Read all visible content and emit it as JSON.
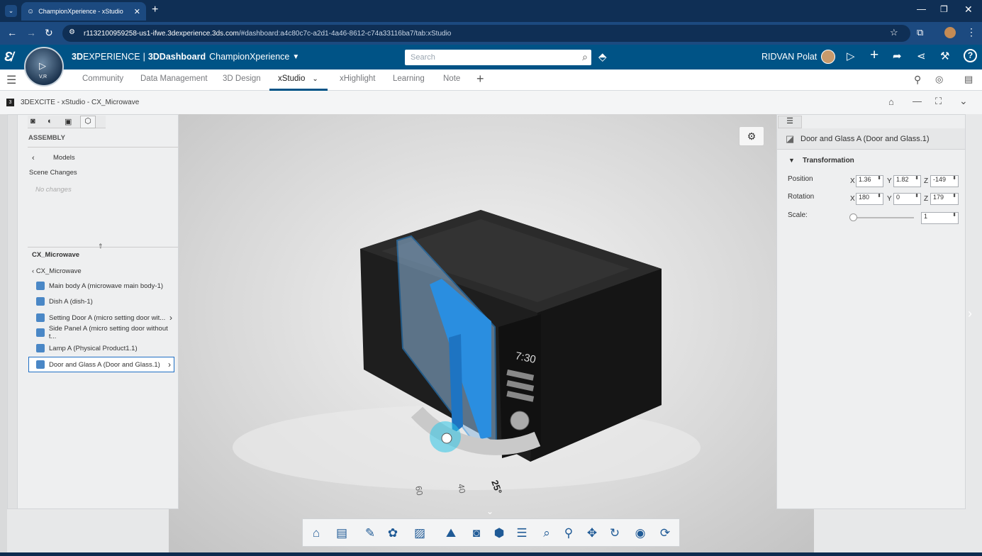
{
  "browser": {
    "tab_title": "ChampionXperience - xStudio",
    "url_host": "r1132100959258-us1-ifwe.3dexperience.3ds.com",
    "url_path": "/#dashboard:a4c80c7c-a2d1-4a46-8612-c74a33116ba7/tab:xStudio"
  },
  "header": {
    "brand_bold": "3D",
    "brand_rest": "EXPERIENCE",
    "sep": "|",
    "app": "3DDashboard",
    "dashboard": "ChampionXperience",
    "search_placeholder": "Search",
    "user": "RIDVAN Polat",
    "compass_label": "V,R"
  },
  "tabs": [
    {
      "label": "Community"
    },
    {
      "label": "Data Management"
    },
    {
      "label": "3D Design"
    },
    {
      "label": "xStudio"
    },
    {
      "label": "xHighlight"
    },
    {
      "label": "Learning"
    },
    {
      "label": "Note"
    }
  ],
  "window": {
    "title": "3DEXCITE - xStudio - CX_Microwave"
  },
  "left_panel": {
    "section": "ASSEMBLY",
    "back_label": "Models",
    "scene_changes": "Scene Changes",
    "no_changes": "No changes",
    "tree_title": "CX_Microwave",
    "tree_root": "CX_Microwave",
    "items": [
      {
        "label": "Main body A (microwave main body-1)"
      },
      {
        "label": "Dish A (dish-1)"
      },
      {
        "label": "Setting Door A (micro setting door wit..."
      },
      {
        "label": "Side Panel A (micro setting door without t..."
      },
      {
        "label": "Lamp A (Physical Product1.1)"
      },
      {
        "label": "Door and Glass A (Door and Glass.1)"
      }
    ]
  },
  "right_panel": {
    "object_title": "Door and Glass A (Door and Glass.1)",
    "section": "Transformation",
    "position_label": "Position",
    "rotation_label": "Rotation",
    "scale_label": "Scale:",
    "x": "X",
    "y": "Y",
    "z": "Z",
    "position": {
      "x": "1.36",
      "y": "1.82",
      "z": "-149"
    },
    "rotation": {
      "x": "180",
      "y": "0",
      "z": "179"
    },
    "scale": "1"
  },
  "scene": {
    "display_time": "7:30",
    "protractor_labels": [
      "60",
      "40",
      "25°"
    ]
  },
  "colors": {
    "header_blue": "#005386",
    "highlight_blue": "#2a8ee0",
    "selection": "#1f6fc4"
  }
}
